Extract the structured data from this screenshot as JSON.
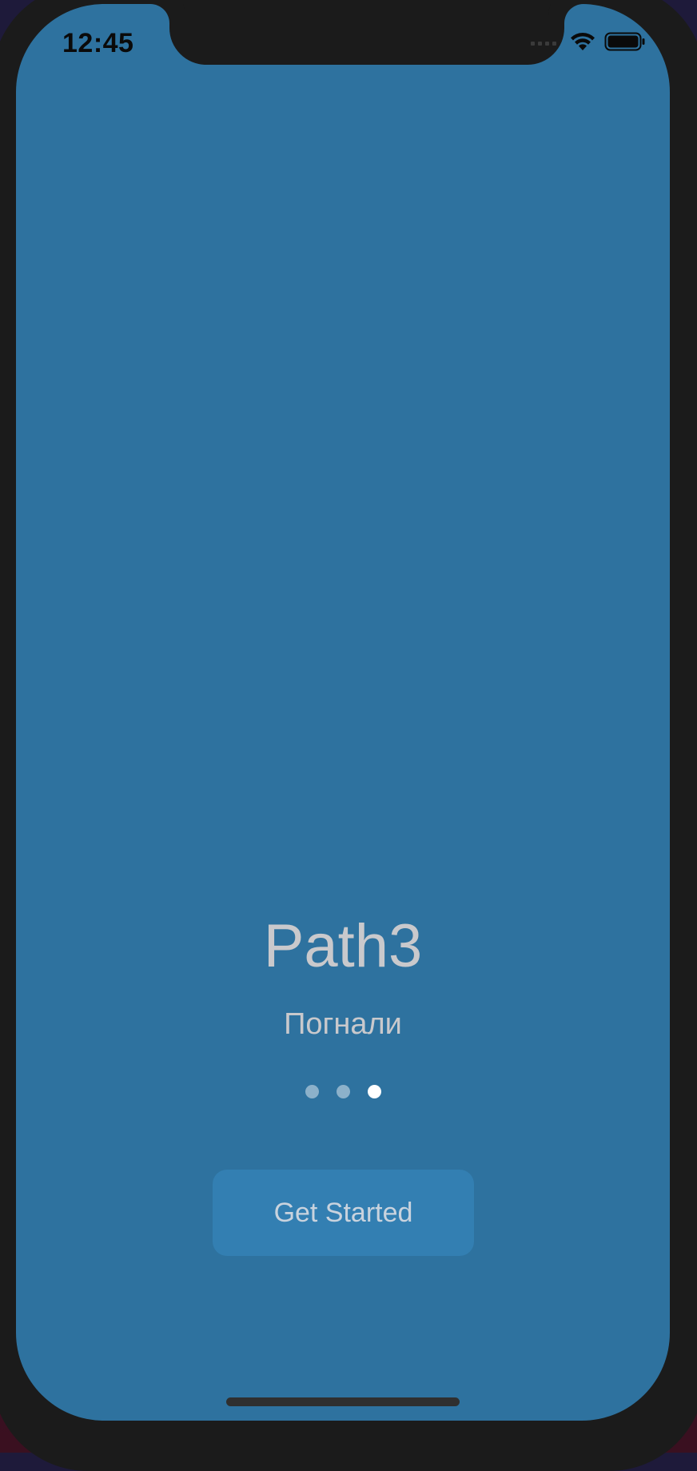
{
  "status_bar": {
    "time": "12:45"
  },
  "onboarding": {
    "title": "Path3",
    "subtitle": "Погнали",
    "pages": [
      {
        "active": false
      },
      {
        "active": false
      },
      {
        "active": true
      }
    ],
    "get_started_label": "Get Started"
  },
  "colors": {
    "screen_background": "#2e729f",
    "button_background": "#337fb2",
    "text": "#c9c9cc",
    "active_dot": "#ffffff"
  },
  "icons": {
    "signal": "cellular-signal-icon",
    "wifi": "wifi-icon",
    "battery": "battery-icon"
  }
}
